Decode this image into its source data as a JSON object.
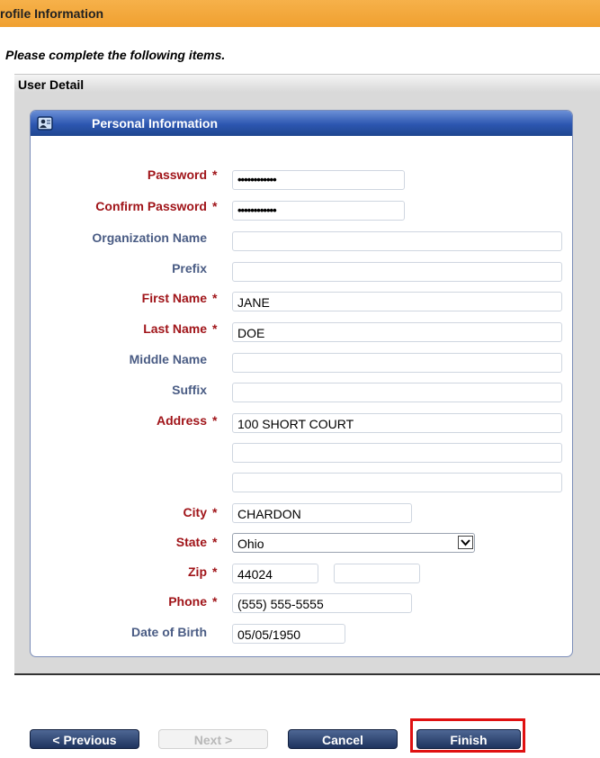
{
  "header": {
    "title": "rofile Information"
  },
  "instructions": "Please complete the following items.",
  "section": {
    "title": "User Detail"
  },
  "panel": {
    "title": "Personal Information",
    "icon": "contact-card-icon"
  },
  "required_marker": "*",
  "form": {
    "password": {
      "label": "Password",
      "value": "••••••••••••"
    },
    "confirm_password": {
      "label": "Confirm Password",
      "value": "••••••••••••"
    },
    "organization": {
      "label": "Organization Name",
      "value": ""
    },
    "prefix": {
      "label": "Prefix",
      "value": ""
    },
    "first_name": {
      "label": "First Name",
      "value": "JANE"
    },
    "last_name": {
      "label": "Last Name",
      "value": "DOE"
    },
    "middle_name": {
      "label": "Middle Name",
      "value": ""
    },
    "suffix": {
      "label": "Suffix",
      "value": ""
    },
    "address": {
      "label": "Address",
      "line1": "100 SHORT COURT",
      "line2": "",
      "line3": ""
    },
    "city": {
      "label": "City",
      "value": "CHARDON"
    },
    "state": {
      "label": "State",
      "value": "Ohio"
    },
    "zip": {
      "label": "Zip",
      "value": "44024",
      "ext": ""
    },
    "phone": {
      "label": "Phone",
      "value": "(555) 555-5555"
    },
    "dob": {
      "label": "Date of Birth",
      "value": "05/05/1950"
    }
  },
  "buttons": {
    "previous": "< Previous",
    "next": "Next >",
    "cancel": "Cancel",
    "finish": "Finish"
  },
  "colors": {
    "header_orange": "#f0a030",
    "panel_blue": "#2c56b0",
    "required_red": "#a01419",
    "optional_blue": "#4a5c84",
    "highlight_red": "#e01111"
  }
}
